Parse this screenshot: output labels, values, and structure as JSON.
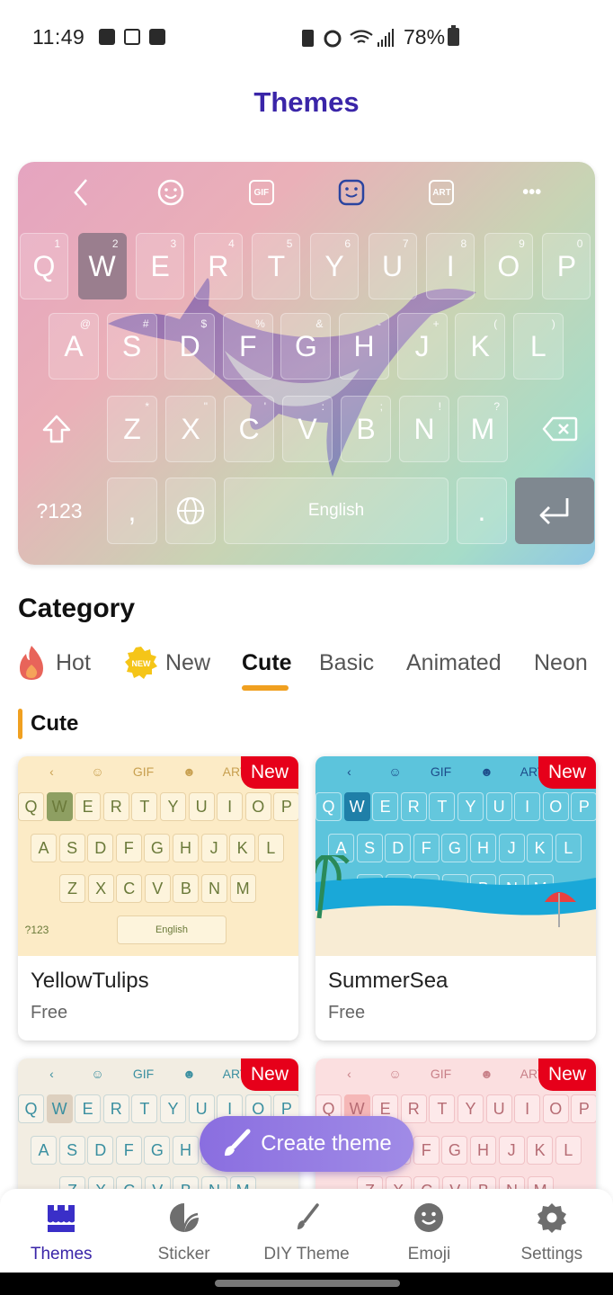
{
  "status_bar": {
    "time": "11:49",
    "left_icons": [
      "font-icon",
      "touch-icon",
      "image-icon"
    ],
    "right_icons": [
      "battery-saver-icon",
      "alarm-icon",
      "wifi-icon",
      "signal-icon"
    ],
    "battery": "78%"
  },
  "header": {
    "title": "Themes"
  },
  "preview": {
    "toolbar": [
      "back-icon",
      "emoji-icon",
      "gif-icon",
      "sticker-icon",
      "art-icon",
      "more-icon"
    ],
    "toolbar_labels": {
      "gif": "GIF",
      "art": "ART",
      "more": "•••",
      "back": "‹"
    },
    "rows": [
      {
        "keys": [
          {
            "k": "Q",
            "h": "1"
          },
          {
            "k": "W",
            "h": "2"
          },
          {
            "k": "E",
            "h": "3"
          },
          {
            "k": "R",
            "h": "4"
          },
          {
            "k": "T",
            "h": "5"
          },
          {
            "k": "Y",
            "h": "6"
          },
          {
            "k": "U",
            "h": "7"
          },
          {
            "k": "I",
            "h": "8"
          },
          {
            "k": "O",
            "h": "9"
          },
          {
            "k": "P",
            "h": "0"
          }
        ]
      },
      {
        "keys": [
          {
            "k": "A",
            "h": "@"
          },
          {
            "k": "S",
            "h": "#"
          },
          {
            "k": "D",
            "h": "$"
          },
          {
            "k": "F",
            "h": "%"
          },
          {
            "k": "G",
            "h": "&"
          },
          {
            "k": "H",
            "h": "-"
          },
          {
            "k": "J",
            "h": "+"
          },
          {
            "k": "K",
            "h": "("
          },
          {
            "k": "L",
            "h": ")"
          }
        ]
      },
      {
        "keys": [
          {
            "k": "Z",
            "h": "*"
          },
          {
            "k": "X",
            "h": "\""
          },
          {
            "k": "C",
            "h": "'"
          },
          {
            "k": "V",
            "h": ":"
          },
          {
            "k": "B",
            "h": ";"
          },
          {
            "k": "N",
            "h": "!"
          },
          {
            "k": "M",
            "h": "?"
          }
        ]
      }
    ],
    "symbols_key": "?123",
    "comma_key": ",",
    "space_label": "English",
    "period_key": ".",
    "active_key": "W"
  },
  "category": {
    "title": "Category",
    "tabs": [
      {
        "label": "Hot",
        "icon": "flame-icon"
      },
      {
        "label": "New",
        "icon": "new-badge-icon",
        "badge_text": "NEW"
      },
      {
        "label": "Cute",
        "active": true
      },
      {
        "label": "Basic"
      },
      {
        "label": "Animated"
      },
      {
        "label": "Neon"
      }
    ],
    "accent_color": "#f0a020"
  },
  "section": {
    "title": "Cute"
  },
  "themes": [
    {
      "name": "YellowTulips",
      "price": "Free",
      "tag": "New"
    },
    {
      "name": "SummerSea",
      "price": "Free",
      "tag": "New"
    },
    {
      "name": "",
      "price": "",
      "tag": "New"
    },
    {
      "name": "",
      "price": "",
      "tag": "New"
    }
  ],
  "mini_keyboard": {
    "row1": [
      "Q",
      "W",
      "E",
      "R",
      "T",
      "Y",
      "U",
      "I",
      "O",
      "P"
    ],
    "row2": [
      "A",
      "S",
      "D",
      "F",
      "G",
      "H",
      "J",
      "K",
      "L"
    ],
    "row3": [
      "Z",
      "X",
      "C",
      "V",
      "B",
      "N",
      "M"
    ],
    "symbols": "?123",
    "space": "English",
    "toolbar": [
      "‹",
      "☺",
      "GIF",
      "☻",
      "ART"
    ]
  },
  "fab": {
    "label": "Create theme",
    "icon": "paintbrush-icon"
  },
  "bottom_nav": [
    {
      "label": "Themes",
      "icon": "themes-store-icon",
      "active": true
    },
    {
      "label": "Sticker",
      "icon": "sticker-icon"
    },
    {
      "label": "DIY Theme",
      "icon": "brush-icon"
    },
    {
      "label": "Emoji",
      "icon": "emoji-icon"
    },
    {
      "label": "Settings",
      "icon": "gear-icon"
    }
  ],
  "colors": {
    "brand": "#3a25a8",
    "new_tag": "#e6001a",
    "fab": "#8a6ee0"
  }
}
